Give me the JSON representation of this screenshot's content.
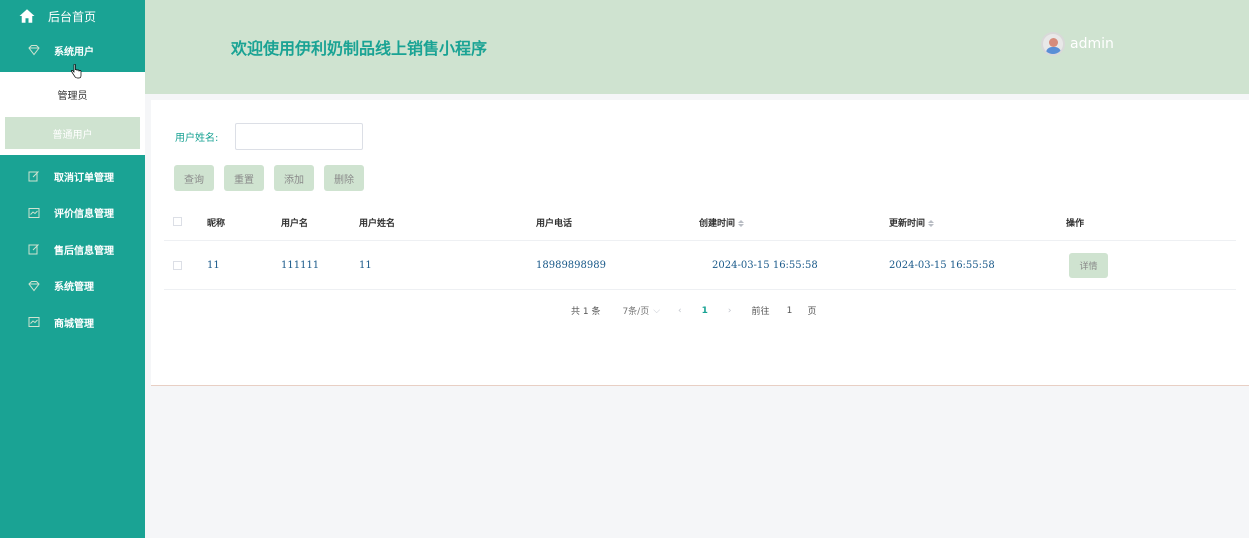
{
  "sidebar": {
    "home_label": "后台首页",
    "system_user_label": "系统用户",
    "sub_items": [
      {
        "label": "管理员"
      },
      {
        "label": "普通用户"
      }
    ],
    "items": [
      {
        "label": "取消订单管理",
        "icon": "edit-icon"
      },
      {
        "label": "评价信息管理",
        "icon": "chart-icon"
      },
      {
        "label": "售后信息管理",
        "icon": "edit-icon"
      },
      {
        "label": "系统管理",
        "icon": "diamond-icon"
      },
      {
        "label": "商城管理",
        "icon": "chart-icon"
      }
    ]
  },
  "header": {
    "title": "欢迎使用伊利奶制品线上销售小程序",
    "user": "admin"
  },
  "search": {
    "label": "用户姓名:",
    "value": "",
    "placeholder": ""
  },
  "buttons": {
    "query": "查询",
    "reset": "重置",
    "add": "添加",
    "delete": "删除"
  },
  "table": {
    "columns": [
      "昵称",
      "用户名",
      "用户姓名",
      "用户电话",
      "创建时间",
      "更新时间",
      "操作"
    ],
    "rows": [
      {
        "nickname": "11",
        "username": "111111",
        "realname": "11",
        "phone": "18989898989",
        "created": "2024-03-15 16:55:58",
        "updated": "2024-03-15 16:55:58",
        "action": "详情"
      }
    ]
  },
  "pagination": {
    "total": "共 1 条",
    "page_size": "7条/页",
    "current_page": "1",
    "goto_label": "前往",
    "goto_value": "1",
    "page_suffix": "页"
  },
  "colors": {
    "sidebar": "#1aa394",
    "header": "#cfe3d0",
    "button": "#cfe3d0",
    "accent": "#1aa394"
  }
}
